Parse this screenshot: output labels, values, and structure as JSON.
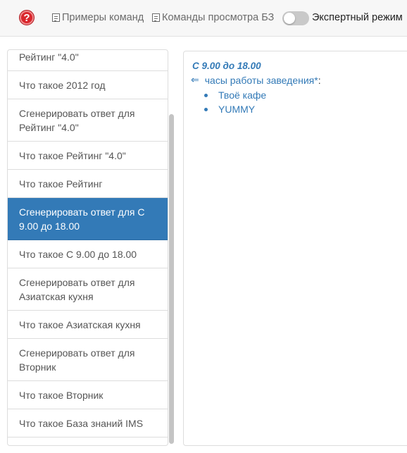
{
  "topbar": {
    "help_glyph": "?",
    "examples_label": "Примеры команд",
    "kb_commands_label": "Команды просмотра БЗ",
    "expert_mode_label": "Экспертный режим",
    "expert_mode_on": false
  },
  "left_list": {
    "items": [
      {
        "label": "Рейтинг \"4.0\"",
        "active": false
      },
      {
        "label": "Что такое 2012 год",
        "active": false
      },
      {
        "label": "Сгенерировать ответ для Рейтинг \"4.0\"",
        "active": false
      },
      {
        "label": "Что такое Рейтинг \"4.0\"",
        "active": false
      },
      {
        "label": "Что такое Рейтинг",
        "active": false
      },
      {
        "label": "Сгенерировать ответ для С 9.00 до 18.00",
        "active": true
      },
      {
        "label": "Что такое С 9.00 до 18.00",
        "active": false
      },
      {
        "label": "Сгенерировать ответ для Азиатская кухня",
        "active": false
      },
      {
        "label": "Что такое Азиатская кухня",
        "active": false
      },
      {
        "label": "Сгенерировать ответ для Вторник",
        "active": false
      },
      {
        "label": "Что такое Вторник",
        "active": false
      },
      {
        "label": "Что такое База знаний IMS",
        "active": false
      }
    ]
  },
  "answer": {
    "title": "С 9.00 до 18.00",
    "relation_symbol": "⇐",
    "relation_name": "часы работы заведения*",
    "relation_colon": ":",
    "values": [
      "Твоё кафе",
      "YUMMY"
    ]
  },
  "colors": {
    "accent": "#337ab7",
    "help_red": "#d9262c",
    "toggle_off": "#c9c9c9"
  }
}
